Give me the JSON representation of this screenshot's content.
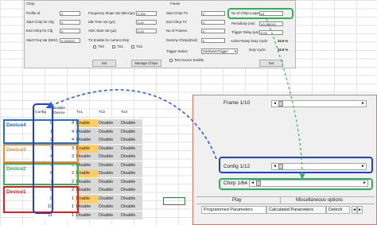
{
  "chirp": {
    "section_title": "Chirp",
    "profile_id": {
      "label": "Profile Id",
      "value": "0"
    },
    "start_chirp_cfg": {
      "label": "Start Chirp for Cfg",
      "value": "0"
    },
    "end_chirp_cfg": {
      "label": "End Chirp for Cfg",
      "value": "0"
    },
    "start_freq_var": {
      "label": "Start Freq Var (MHz)",
      "value": "0.000000"
    },
    "freq_slope_var": {
      "label": "Frequency Slope Var (MHz/µs)",
      "value": "0.000"
    },
    "idle_time_var": {
      "label": "Idle Time Var (µs)",
      "value": "0.00"
    },
    "adc_start_var": {
      "label": "ADC Start Var (µs)",
      "value": "0.00"
    },
    "tx_enable_label": "TX Enable for current chirp",
    "tx_checks": [
      "TX0",
      "TX1",
      "TX2"
    ],
    "set_button": "Set",
    "manage_button": "Manage Chirps"
  },
  "frame": {
    "section_title": "Frame",
    "start_chirp_tx": {
      "label": "Start Chirp TX",
      "value": "0"
    },
    "end_chirp_tx": {
      "label": "End Chirp TX",
      "value": "0"
    },
    "num_frames": {
      "label": "No of Frames",
      "value": "0"
    },
    "dummy_chirps": {
      "label": "Dummy Chirps(End)",
      "value": "0"
    },
    "chirp_loops": {
      "label": "No of Chirp Loops",
      "value": "64"
    },
    "periodicity": {
      "label": "Periodicity (ms)",
      "value": "40.000000"
    },
    "trigger_delay": {
      "label": "Trigger Delay (µs)",
      "value": "0.00"
    },
    "active_ramp_label": "Active-Ramp Duty Cycle",
    "active_ramp_value": "34.6 %",
    "duty_cycle_label": "Duty Cycle",
    "duty_cycle_value": "34.6 %",
    "trigger_select_label": "Trigger Select",
    "trigger_select_value": "HardwareTrigger",
    "test_source_label": "Test Source Enable",
    "set_button": "Set"
  },
  "table": {
    "headers": [
      "Config",
      "Enable Device",
      "Tx1",
      "Tx2",
      "Tx3"
    ],
    "rows": [
      {
        "config": "0",
        "device": "4",
        "tx": [
          "Enable",
          "Disable",
          "Disable"
        ]
      },
      {
        "config": "1",
        "device": "4",
        "tx": [
          "Disable",
          "Disable",
          "Disable"
        ]
      },
      {
        "config": "2",
        "device": "4",
        "tx": [
          "Disable",
          "Disable",
          "Disable"
        ]
      },
      {
        "config": "3",
        "device": "3",
        "tx": [
          "Enable",
          "Disable",
          "Disable"
        ]
      },
      {
        "config": "4",
        "device": "3",
        "tx": [
          "Disable",
          "Disable",
          "Disable"
        ]
      },
      {
        "config": "5",
        "device": "3",
        "tx": [
          "Disable",
          "Disable",
          "Disable"
        ]
      },
      {
        "config": "6",
        "device": "2",
        "tx": [
          "Enable",
          "Disable",
          "Disable"
        ]
      },
      {
        "config": "7",
        "device": "2",
        "tx": [
          "Disable",
          "Disable",
          "Disable"
        ]
      },
      {
        "config": "8",
        "device": "2",
        "tx": [
          "Disable",
          "Disable",
          "Disable"
        ]
      },
      {
        "config": "9",
        "device": "1",
        "tx": [
          "Enable",
          "Disable",
          "Disable"
        ]
      },
      {
        "config": "10",
        "device": "1",
        "tx": [
          "Disable",
          "Disable",
          "Disable"
        ]
      },
      {
        "config": "11",
        "device": "1",
        "tx": [
          "Disable",
          "Disable",
          "Disable"
        ]
      }
    ]
  },
  "devices": [
    {
      "label": "Device4",
      "color": "#1f6fd6"
    },
    {
      "label": "Device3",
      "color": "#f08a24"
    },
    {
      "label": "Device2",
      "color": "#2fb05a"
    },
    {
      "label": "Device1",
      "color": "#e02020"
    }
  ],
  "colors": {
    "enable": "#ffcc66",
    "disable": "#d9d9d9",
    "config_box": "#1f3fd6",
    "arrow_blue": "#2f5fe0",
    "arrow_green": "#2fb05a"
  },
  "panel": {
    "frame_label": "Frame 1/10",
    "config_label": "Config 1/12",
    "chirp_label": "Chirp 1/64",
    "col_play": "Play",
    "col_misc": "Miscellaneous options",
    "tabs": [
      "Programmed Parameters",
      "Calculated Parameters",
      "Detecti"
    ],
    "left_arrow": "◄",
    "right_arrow": "►"
  }
}
